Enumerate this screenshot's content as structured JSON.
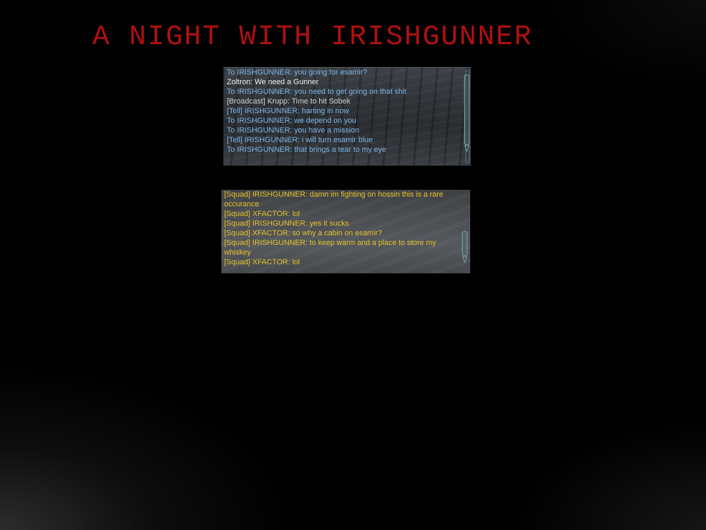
{
  "page": {
    "title": "A NIGHT WITH IRISHGUNNER"
  },
  "colors": {
    "title": "#b01010",
    "tell": "#7fb5e6",
    "local": "#f2f2f2",
    "broadcast": "#cfcfcf",
    "squad": "#e6c229",
    "background": "#000000"
  },
  "icons": {
    "scroll_down": "chevron-down-icon"
  },
  "tell_chat": {
    "messages": [
      {
        "channel": "tell",
        "text": "To IRISHGUNNER: you going for esamir?"
      },
      {
        "channel": "local",
        "text": "Zoltron: We need a Gunner"
      },
      {
        "channel": "tell",
        "text": "To IRISHGUNNER: you need to get going on that shit"
      },
      {
        "channel": "broadcast",
        "text": "[Broadcast] Krupp: Time to hit Sobek"
      },
      {
        "channel": "tell",
        "text": "[Tell] IRISHGUNNER: harting in now"
      },
      {
        "channel": "tell",
        "text": "To IRISHGUNNER: we depend on you"
      },
      {
        "channel": "tell",
        "text": "To IRISHGUNNER: you have a mission"
      },
      {
        "channel": "tell",
        "text": "[Tell] IRISHGUNNER: i will turn esamir blue"
      },
      {
        "channel": "tell",
        "text": "To IRISHGUNNER: that brings a tear to my eye"
      }
    ]
  },
  "squad_chat": {
    "messages": [
      {
        "channel": "squad",
        "text": "[Squad] IRISHGUNNER: damn im fighting on hossin this is a rare occurance"
      },
      {
        "channel": "squad",
        "text": "[Squad] XFACTOR: lol"
      },
      {
        "channel": "squad",
        "text": "[Squad] IRISHGUNNER: yes it sucks"
      },
      {
        "channel": "squad",
        "text": "[Squad] XFACTOR: so why a cabin on esamir?"
      },
      {
        "channel": "squad",
        "text": "[Squad] IRISHGUNNER: to keep warm and a place to store my whiskey"
      },
      {
        "channel": "squad",
        "text": "[Squad] XFACTOR: lol"
      }
    ]
  }
}
